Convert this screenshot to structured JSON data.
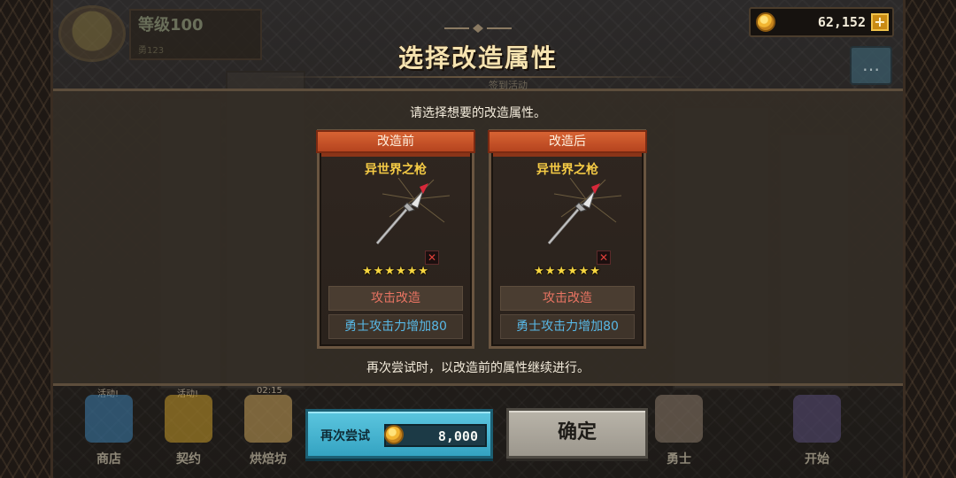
{
  "hud": {
    "level": "等级100",
    "level_sub": "勇123",
    "coins": "62,152",
    "add_icon": "plus-icon",
    "chat_icon": "chat-bubble-icon"
  },
  "dialog": {
    "title": "选择改造属性",
    "ghost_text": "签到活动",
    "instruction": "请选择想要的改造属性。",
    "footnote": "再次尝试时，以改造前的属性继续进行。",
    "cards": [
      {
        "header": "改造前",
        "item_name": "异世界之枪",
        "stars": "★★★★★★",
        "mod_type": "攻击改造",
        "mod_effect": "勇士攻击力增加80"
      },
      {
        "header": "改造后",
        "item_name": "异世界之枪",
        "stars": "★★★★★★",
        "mod_type": "攻击改造",
        "mod_effect": "勇士攻击力增加80"
      }
    ],
    "retry_button": {
      "label": "再次尝试",
      "cost": "8,000"
    },
    "confirm_button": {
      "label": "确定"
    }
  },
  "bottom_menu": [
    {
      "label": "商店",
      "badge": "活动!",
      "icon": "diamond-icon",
      "color": "#3c7fb1"
    },
    {
      "label": "契约",
      "badge": "活动!",
      "icon": "contract-icon",
      "color": "#c79a2a"
    },
    {
      "label": "烘焙坊",
      "badge": "02:15",
      "icon": "bakery-icon",
      "color": "#c9a25a"
    },
    {
      "label": "勇士",
      "badge": "",
      "icon": "helmet-icon",
      "color": "#8a7a6a"
    },
    {
      "label": "开始",
      "badge": "",
      "icon": "start-icon",
      "color": "#5a4e7a"
    }
  ],
  "colors": {
    "card_header": "#d76333",
    "item_name": "#f5cb45",
    "mod_type": "#e87462",
    "mod_effect": "#58b8e6",
    "retry": "#4bb6d2",
    "confirm": "#aaa59b"
  }
}
